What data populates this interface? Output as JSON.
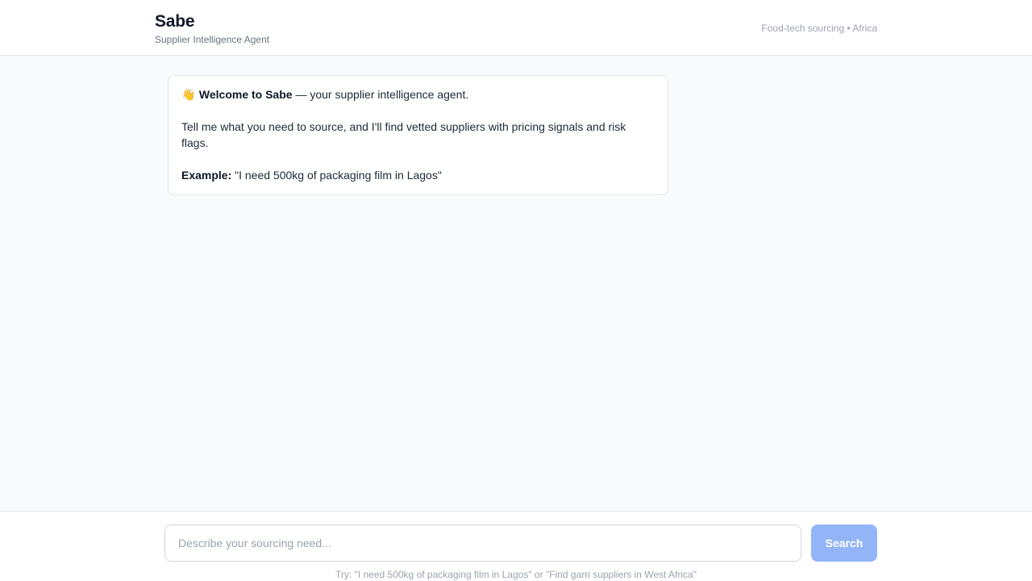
{
  "header": {
    "title": "Sabe",
    "subtitle": "Supplier Intelligence Agent",
    "tag": "Food-tech sourcing • Africa"
  },
  "welcome": {
    "icon": "waving-hand-icon",
    "icon_glyph": "👋",
    "title": "Welcome to Sabe",
    "title_suffix": " — your supplier intelligence agent.",
    "body": "Tell me what you need to source, and I'll find vetted suppliers with pricing signals and risk flags.",
    "example_label": "Example:",
    "example_text": " \"I need 500kg of packaging film in Lagos\""
  },
  "composer": {
    "placeholder": "Describe your sourcing need...",
    "value": "",
    "button_label": "Search",
    "hint": "Try: \"I need 500kg of packaging film in Lagos\" or \"Find garri suppliers in West Africa\""
  },
  "colors": {
    "background": "#f8fafc",
    "button": "#93b4f6",
    "border": "#e5e7eb",
    "muted_text": "#9ca3af"
  }
}
